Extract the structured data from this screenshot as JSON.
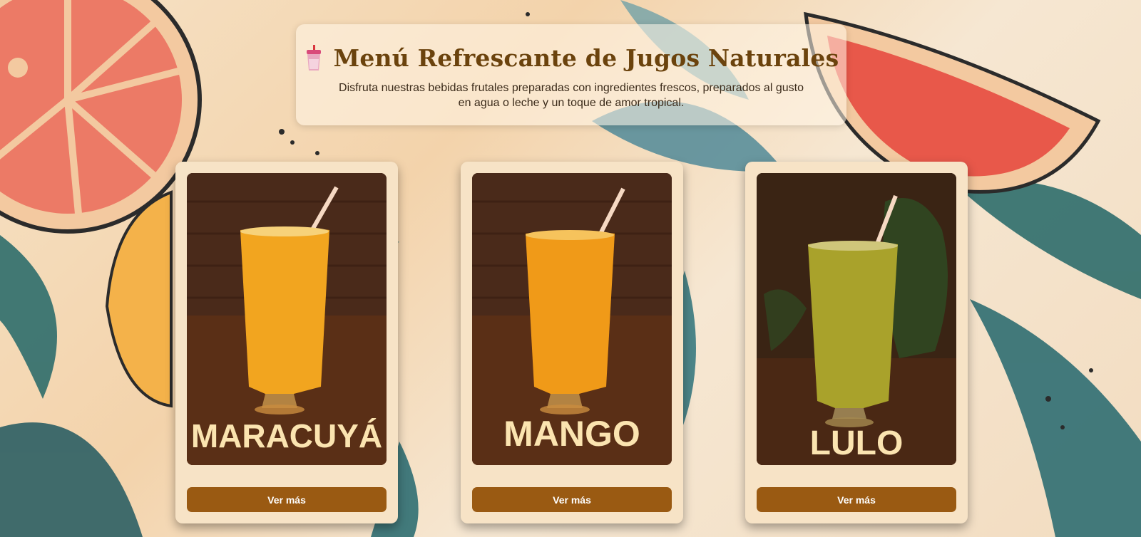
{
  "header": {
    "icon": "cup-icon",
    "title": "Menú Refrescante de Jugos Naturales",
    "subtitle": "Disfruta nuestras bebidas frutales preparadas con ingredientes frescos, preparados al gusto en agua o leche y un toque de amor tropical."
  },
  "cards": [
    {
      "label": "MARACUYÁ",
      "button": "Ver más",
      "juice_color": "#f2a51f"
    },
    {
      "label": "MANGO",
      "button": "Ver más",
      "juice_color": "#f09a18"
    },
    {
      "label": "LULO",
      "button": "Ver más",
      "juice_color": "#a9a22b"
    }
  ],
  "colors": {
    "title": "#6b430d",
    "button": "#9a5a12",
    "card": "#f7e3c6"
  }
}
